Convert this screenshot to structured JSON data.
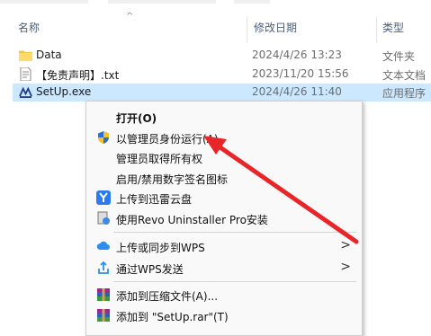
{
  "columns": {
    "name": "名称",
    "date_modified": "修改日期",
    "type": "类型"
  },
  "files": [
    {
      "name": "Data",
      "date": "2024/4/26 13:23",
      "type": "文件夹",
      "icon": "folder-icon"
    },
    {
      "name": "【免责声明】.txt",
      "date": "2023/11/20 15:56",
      "type": "文本文档",
      "icon": "text-file-icon"
    },
    {
      "name": "SetUp.exe",
      "date": "2024/4/26 11:40",
      "type": "应用程序",
      "icon": "setup-exe-icon",
      "selected": true
    }
  ],
  "context_menu": {
    "items": [
      {
        "label": "打开(O)",
        "bold": true
      },
      {
        "label": "以管理员身份运行(A)",
        "icon": "uac-shield-icon"
      },
      {
        "label": "管理员取得所有权"
      },
      {
        "label": "启用/禁用数字签名图标"
      },
      {
        "label": "上传到迅雷云盘",
        "icon": "xunlei-icon"
      },
      {
        "label": "使用Revo Uninstaller Pro安装",
        "icon": "revo-uninstaller-icon"
      },
      {
        "label": "上传或同步到WPS",
        "icon": "wps-cloud-icon",
        "submenu": true
      },
      {
        "label": "通过WPS发送",
        "icon": "wps-share-icon",
        "submenu": true
      },
      {
        "label": "添加到压缩文件(A)...",
        "icon": "winrar-icon"
      },
      {
        "label": "添加到 \"SetUp.rar\"(T)",
        "icon": "winrar-icon"
      }
    ]
  },
  "colors": {
    "selection": "#cce8ff",
    "annotation_arrow": "#e8262a",
    "folder": "#f4c542"
  }
}
